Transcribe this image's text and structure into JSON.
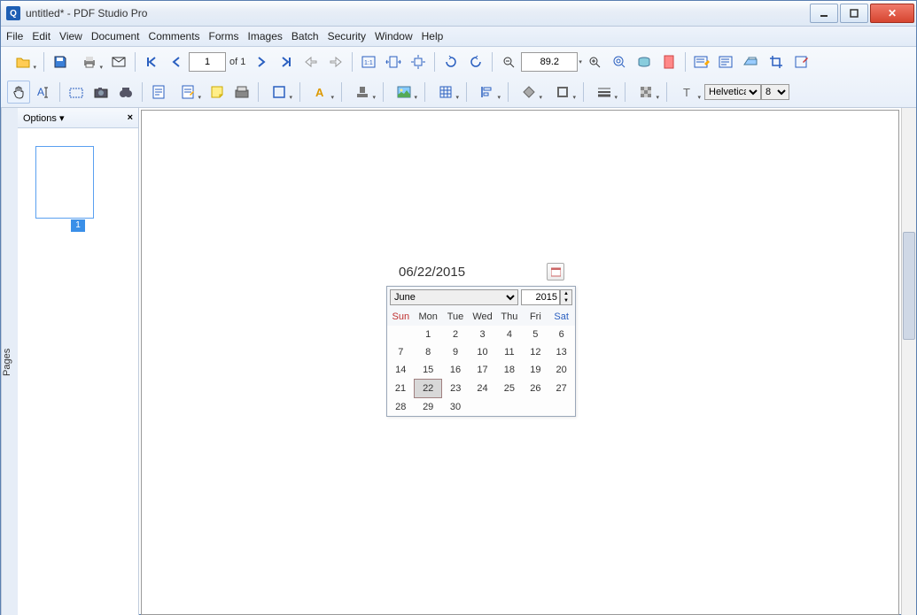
{
  "window": {
    "title": "untitled* - PDF Studio Pro",
    "app_initial": "Q"
  },
  "menu": [
    "File",
    "Edit",
    "View",
    "Document",
    "Comments",
    "Forms",
    "Images",
    "Batch",
    "Security",
    "Window",
    "Help"
  ],
  "nav": {
    "page_value": "1",
    "page_of": "of 1",
    "zoom_value": "89.2"
  },
  "side": {
    "tab": "Pages",
    "options": "Options",
    "thumb_label": "1"
  },
  "date": {
    "display": "06/22/2015",
    "month": "June",
    "year": "2015"
  },
  "cal": {
    "dows": [
      "Sun",
      "Mon",
      "Tue",
      "Wed",
      "Thu",
      "Fri",
      "Sat"
    ],
    "rows": [
      [
        "",
        "1",
        "2",
        "3",
        "4",
        "5",
        "6"
      ],
      [
        "7",
        "8",
        "9",
        "10",
        "11",
        "12",
        "13"
      ],
      [
        "14",
        "15",
        "16",
        "17",
        "18",
        "19",
        "20"
      ],
      [
        "21",
        "22",
        "23",
        "24",
        "25",
        "26",
        "27"
      ],
      [
        "28",
        "29",
        "30",
        "",
        "",
        "",
        ""
      ]
    ],
    "selected": "22"
  },
  "font": {
    "name": "Helvetica",
    "size": "8"
  }
}
